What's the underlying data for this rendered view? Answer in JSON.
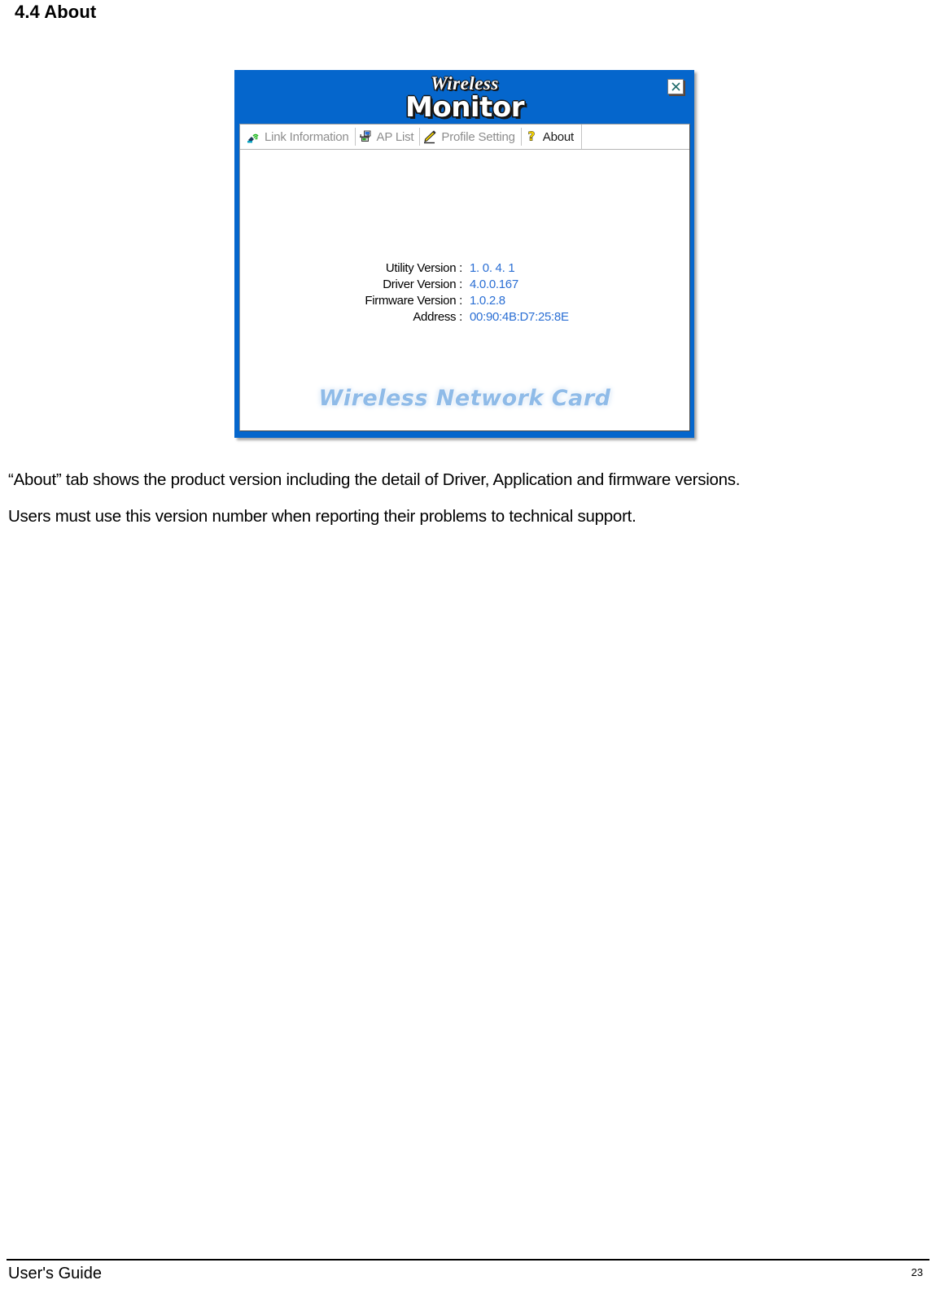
{
  "document": {
    "heading": "4.4 About",
    "paragraphs": [
      "“About” tab shows the product version including the detail of Driver, Application and firmware versions.",
      "Users must use this version number when reporting their problems to technical support."
    ],
    "footer": {
      "left_label": "User's Guide",
      "page_number": "23"
    }
  },
  "app_window": {
    "title_line1": "Wireless",
    "title_line2": "Monitor",
    "close_icon": "close-icon",
    "titlebar_color": "#0566cc",
    "accent_color": "#2b6fd4",
    "tabs": [
      {
        "label": "Link Information",
        "icon": "wireless-signal-icon",
        "active": false
      },
      {
        "label": "AP List",
        "icon": "access-point-icon",
        "active": false
      },
      {
        "label": "Profile Setting",
        "icon": "pencil-profile-icon",
        "active": false
      },
      {
        "label": "About",
        "icon": "question-mark-icon",
        "active": true
      }
    ],
    "about_panel": {
      "rows": [
        {
          "label": "Utility Version :",
          "value": "1. 0. 4. 1"
        },
        {
          "label": "Driver Version :",
          "value": "4.0.0.167"
        },
        {
          "label": "Firmware Version :",
          "value": "1.0.2.8"
        },
        {
          "label": "Address :",
          "value": "00:90:4B:D7:25:8E"
        }
      ],
      "brand_text": "Wireless Network Card"
    }
  }
}
